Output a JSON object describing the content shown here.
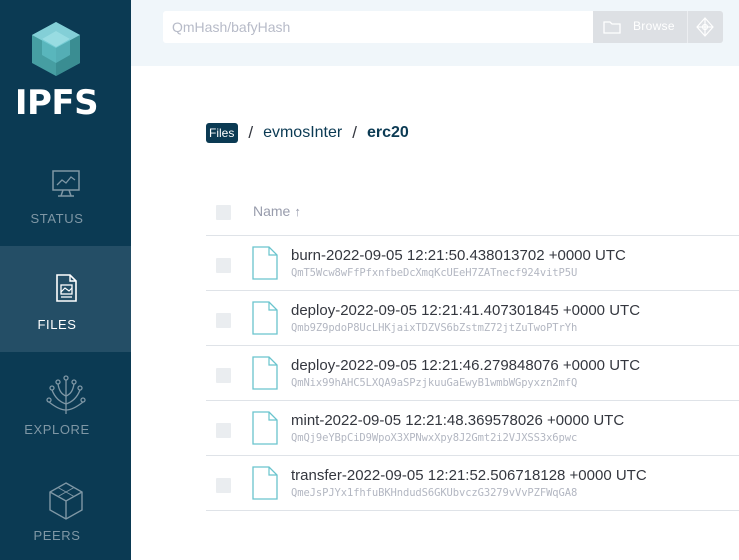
{
  "app": {
    "name": "IPFS",
    "colors": {
      "sidebar": "#0b3a53",
      "sidebar_active": "#244e66",
      "accent_teal": "#69c4cd",
      "topbar": "#f0f6fa"
    }
  },
  "nav": {
    "status": {
      "label": "STATUS",
      "icon": "status-monitor-icon"
    },
    "files": {
      "label": "FILES",
      "icon": "files-icon",
      "active": true
    },
    "explore": {
      "label": "EXPLORE",
      "icon": "explore-tree-icon"
    },
    "peers": {
      "label": "PEERS",
      "icon": "peers-cube-icon"
    }
  },
  "search": {
    "placeholder": "QmHash/bafyHash",
    "value": ""
  },
  "browse": {
    "label": "Browse"
  },
  "breadcrumb": {
    "root": "Files",
    "items": [
      "evmosInter",
      "erc20"
    ],
    "separator": "/"
  },
  "table": {
    "header": {
      "name": "Name",
      "sort_indicator": "↑"
    },
    "files": [
      {
        "name": "burn-2022-09-05 12:21:50.438013702 +0000 UTC",
        "cid": "QmT5Wcw8wFfPfxnfbeDcXmqKcUEeH7ZATnecf924vitP5U"
      },
      {
        "name": "deploy-2022-09-05 12:21:41.407301845 +0000 UTC",
        "cid": "Qmb9Z9pdoP8UcLHKjaixTDZVS6bZstmZ72jtZuTwoPTrYh"
      },
      {
        "name": "deploy-2022-09-05 12:21:46.279848076 +0000 UTC",
        "cid": "QmNix99hAHC5LXQA9aSPzjkuuGaEwyB1wmbWGpyxzn2mfQ"
      },
      {
        "name": "mint-2022-09-05 12:21:48.369578026 +0000 UTC",
        "cid": "QmQj9eYBpCiD9WpoX3XPNwxXpy8J2Gmt2i2VJXSS3x6pwc"
      },
      {
        "name": "transfer-2022-09-05 12:21:52.506718128 +0000 UTC",
        "cid": "QmeJsPJYx1fhfuBKHndudS6GKUbvczG3279vVvPZFWqGA8"
      }
    ]
  }
}
